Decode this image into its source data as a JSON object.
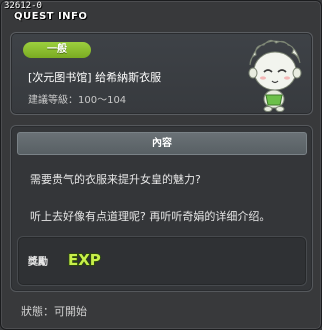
{
  "window": {
    "quest_id": "32612-0",
    "title": "QUEST INFO"
  },
  "quest": {
    "category": "一般",
    "name": "[次元图书馆] 给希納斯衣服",
    "level": "建議等級：100～104"
  },
  "content": {
    "header": "內容",
    "lines": [
      "需要贵气的衣服来提升女皇的魅力?",
      "听上去好像有点道理呢? 再听听奇娟的详细介绍。"
    ]
  },
  "reward": {
    "label": "獎勵",
    "exp_text": "EXP"
  },
  "status": "狀態：可開始",
  "colors": {
    "badge": "#8bbf2f",
    "exp_text": "#c8f04a",
    "panel_border": "#5a5d61"
  }
}
